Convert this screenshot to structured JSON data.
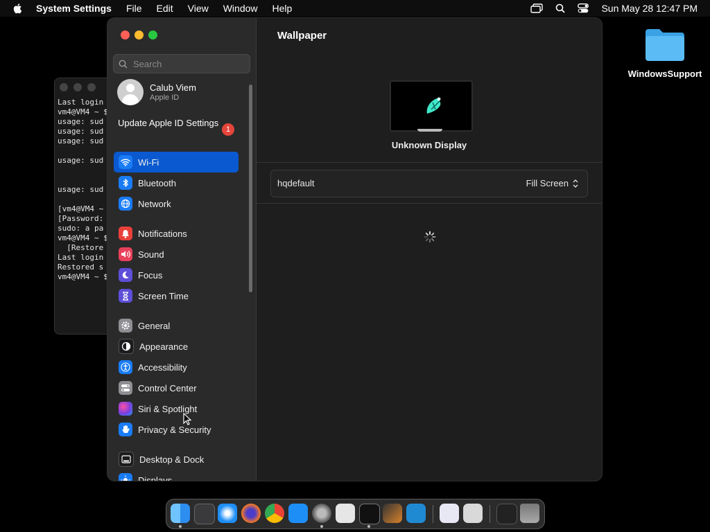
{
  "menubar": {
    "app_name": "System Settings",
    "menus": [
      "File",
      "Edit",
      "View",
      "Window",
      "Help"
    ],
    "clock": "Sun May 28  12:47 PM"
  },
  "terminal": {
    "lines": "Last login\nvm4@VM4 ~ $\nusage: sud\nusage: sud\nusage: sud\n\nusage: sud\n\n\nusage: sud\n\n[vm4@VM4 ~ $\n[Password:\nsudo: a pa\nvm4@VM4 ~ $\n  [Restore\nLast login\nRestored s\nvm4@VM4 ~ $"
  },
  "desktop": {
    "folder_label": "WindowsSupport"
  },
  "sidebar": {
    "search_placeholder": "Search",
    "profile": {
      "name": "Calub Viem",
      "subtitle": "Apple ID"
    },
    "update": {
      "label": "Update Apple ID Settings",
      "badge": "1"
    },
    "items": [
      {
        "label": "Wi-Fi",
        "icon": "wifi-icon",
        "color": "#1a7cf5"
      },
      {
        "label": "Bluetooth",
        "icon": "bluetooth-icon",
        "color": "#1a7cf5"
      },
      {
        "label": "Network",
        "icon": "globe-icon",
        "color": "#1a7cf5"
      },
      {
        "label": "Notifications",
        "icon": "bell-icon",
        "color": "#e8413a"
      },
      {
        "label": "Sound",
        "icon": "speaker-icon",
        "color": "#e8415a"
      },
      {
        "label": "Focus",
        "icon": "moon-icon",
        "color": "#5d4fd8"
      },
      {
        "label": "Screen Time",
        "icon": "hourglass-icon",
        "color": "#5d4fd8"
      },
      {
        "label": "General",
        "icon": "gear-icon",
        "color": "#8e8e93"
      },
      {
        "label": "Appearance",
        "icon": "appearance-icon",
        "color": "#1c1c1e"
      },
      {
        "label": "Accessibility",
        "icon": "accessibility-icon",
        "color": "#1a7cf5"
      },
      {
        "label": "Control Center",
        "icon": "toggles-icon",
        "color": "#8e8e93"
      },
      {
        "label": "Siri & Spotlight",
        "icon": "siri-icon",
        "color": "#a44bd6"
      },
      {
        "label": "Privacy & Security",
        "icon": "hand-icon",
        "color": "#1a7cf5"
      },
      {
        "label": "Desktop & Dock",
        "icon": "dock-icon",
        "color": "#1c1c1e"
      },
      {
        "label": "Displays",
        "icon": "sun-icon",
        "color": "#1a7cf5"
      }
    ]
  },
  "main": {
    "title": "Wallpaper",
    "display_name": "Unknown Display",
    "wallpaper_name": "hqdefault",
    "fill_mode": "Fill Screen"
  }
}
